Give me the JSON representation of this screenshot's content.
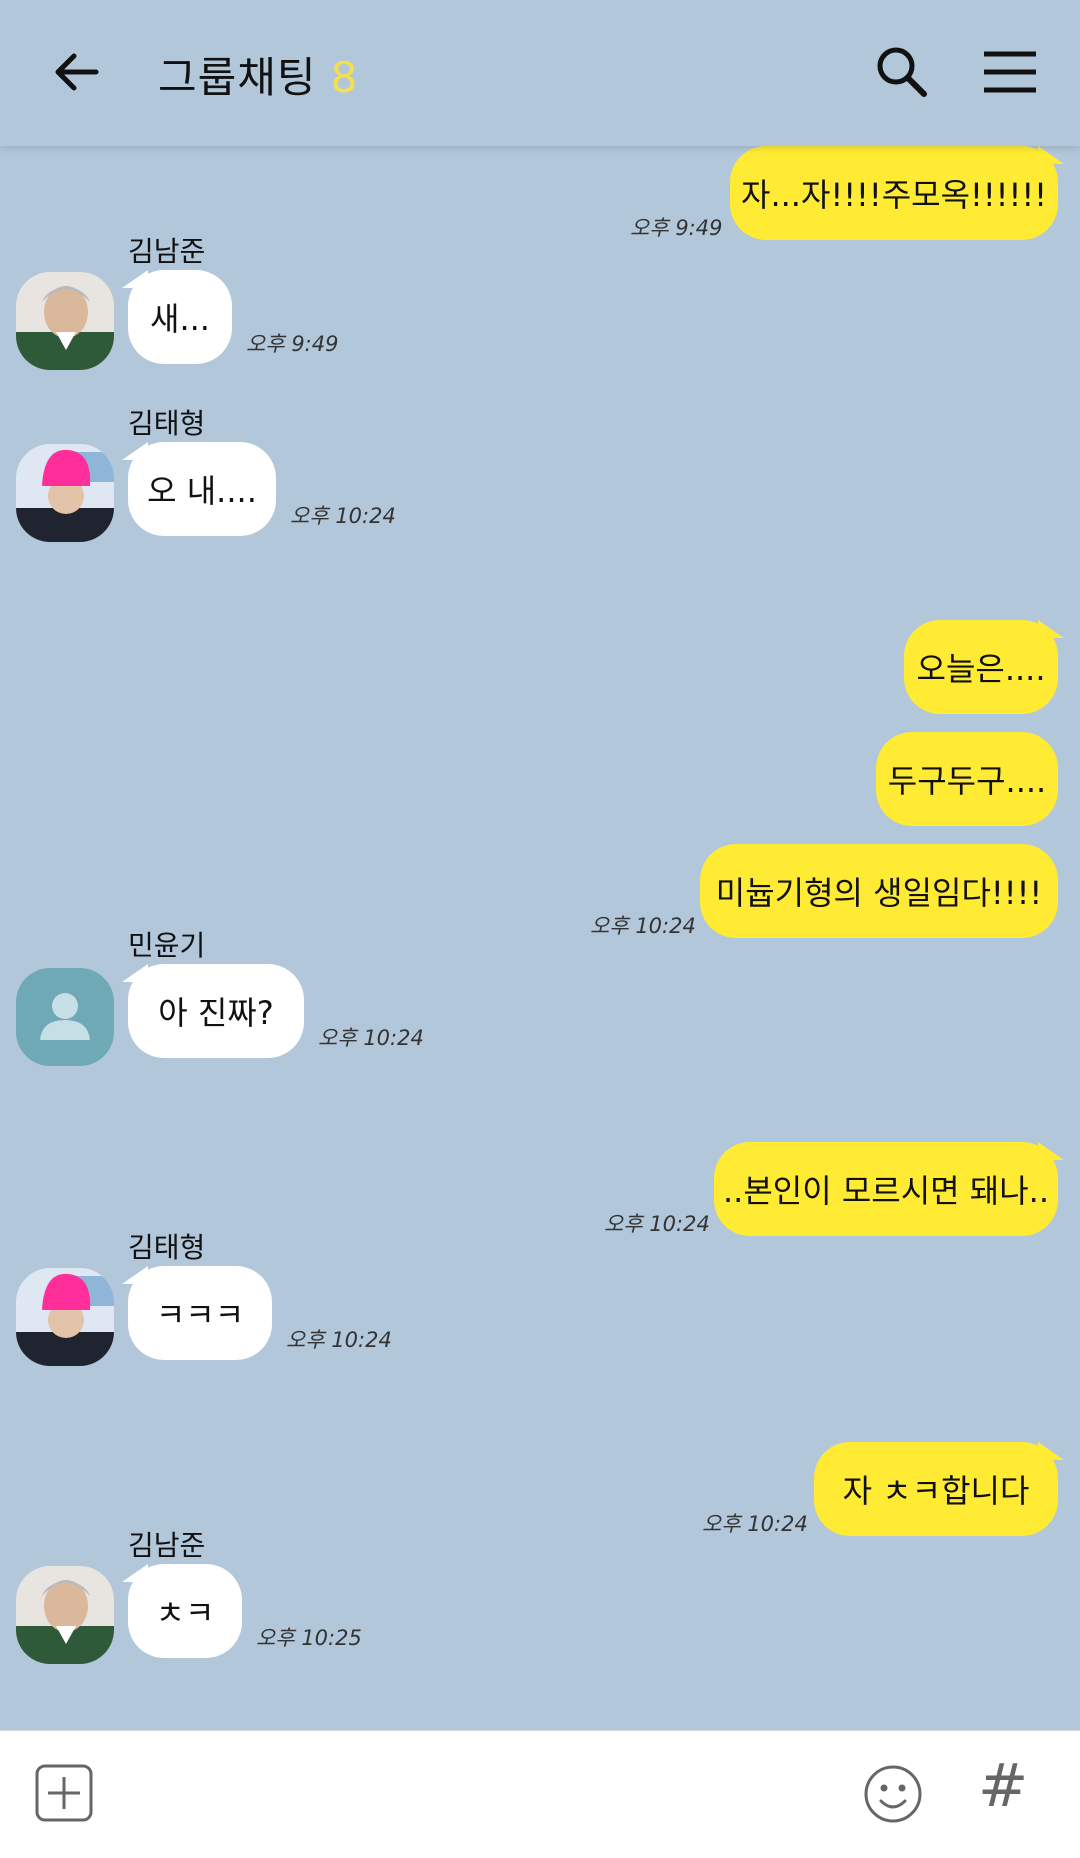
{
  "header": {
    "title": "그룹채팅",
    "member_mark": "8"
  },
  "messages": [
    {
      "side": "me",
      "text": "자...자!!!!주모옥!!!!!!",
      "time": "오후 9:49"
    },
    {
      "side": "other",
      "name": "김남준",
      "text": "새...",
      "time": "오후 9:49"
    },
    {
      "side": "other",
      "name": "김태형",
      "text": "오 내....",
      "time": "오후 10:24"
    },
    {
      "side": "me",
      "text": "오늘은...."
    },
    {
      "side": "me",
      "text": "두구두구...."
    },
    {
      "side": "me",
      "text": "미늅기형의 생일임다!!!!",
      "time": "오후 10:24"
    },
    {
      "side": "other",
      "name": "민윤기",
      "text": "아 진짜?",
      "time": "오후 10:24"
    },
    {
      "side": "me",
      "text": "..본인이 모르시면 돼나..",
      "time": "오후 10:24"
    },
    {
      "side": "other",
      "name": "김태형",
      "text": "ㅋㅋㅋ",
      "time": "오후 10:24"
    },
    {
      "side": "me",
      "text": "자 ㅊㅋ합니다",
      "time": "오후 10:24"
    },
    {
      "side": "other",
      "name": "김남준",
      "text": "ㅊㅋ",
      "time": "오후 10:25"
    }
  ],
  "colors": {
    "background": "#b2c7da",
    "my_bubble": "#ffeb33",
    "other_bubble": "#ffffff",
    "default_avatar": "#6fa9b5"
  },
  "icons": {
    "back": "arrow-left-icon",
    "search": "search-icon",
    "menu": "hamburger-menu-icon",
    "attach": "plus-square-icon",
    "emoji": "smiley-icon",
    "hashtag": "hash-icon"
  },
  "input": {
    "hash_glyph": "#"
  }
}
